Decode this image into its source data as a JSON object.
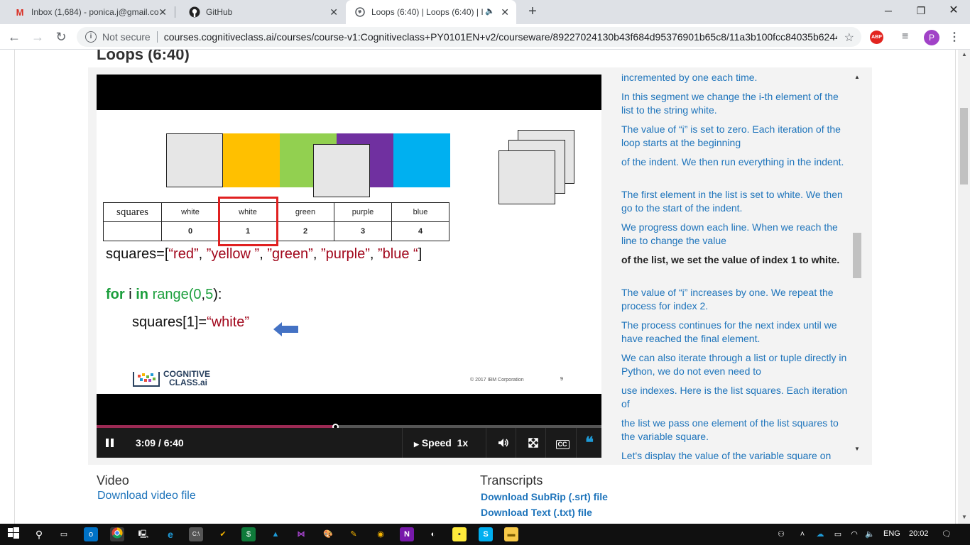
{
  "browser": {
    "tabs": [
      {
        "label": "Inbox (1,684) - ponica.j@gmail.co",
        "icon": "gmail-icon"
      },
      {
        "label": "GitHub",
        "icon": "github-icon"
      },
      {
        "label": "Loops (6:40) | Loops (6:40) | I",
        "icon": "globe-icon",
        "audio_icon": "speaker-icon"
      }
    ],
    "not_secure": "Not secure",
    "url": "courses.cognitiveclass.ai/courses/course-v1:Cognitiveclass+PY0101EN+v2/courseware/89227024130b43f684d95376901b65c8/11a3b100fcc84035b6244...",
    "avatar_letter": "P",
    "abp_label": "ABP"
  },
  "page": {
    "title": "Loops (6:40)"
  },
  "slide": {
    "table_label": "squares",
    "values": [
      "white",
      "white",
      "green",
      "purple",
      "blue"
    ],
    "indices": [
      "0",
      "1",
      "2",
      "3",
      "4"
    ],
    "code_line1_prefix": "squares=[",
    "code_line1_items": [
      "“red”",
      ", ",
      "”yellow ”",
      ", ",
      "”green”",
      ", ",
      "”purple”",
      ", ",
      "”blue “",
      "]"
    ],
    "code_for": "for",
    "code_i": " i ",
    "code_in": "in",
    "code_range": " range(",
    "code_0": "0",
    "code_comma": ",",
    "code_5": "5",
    "code_close": "):",
    "code_line3_prefix": "squares[1]=",
    "code_line3_value": "“white”",
    "logo_line1": "COGNITIVE",
    "logo_line2": "CLASS.ai",
    "copyright": "© 2017 IBM Corporation",
    "slide_number": "9",
    "square_colors": [
      "#e6e6e6",
      "#ffc000",
      "#92d050",
      "#7030a0",
      "#00b0f0"
    ]
  },
  "player": {
    "time": "3:09 / 6:40",
    "speed_label": "Speed",
    "speed_value": "1x",
    "progress": 0.4725,
    "progress_color": "#9c2a54"
  },
  "transcript": {
    "lines": [
      "incremented by one each time.",
      "In this segment we change the i-th element of the list to the string white.",
      "The value of “i” is set to zero. Each iteration of the loop starts at the beginning",
      "of the indent. We then run everything in the indent.",
      "The first element in the list is set to white. We then go to the start of the indent.",
      "We progress down each line. When we reach the line to change the value",
      "of the list, we set the value of index 1 to white.",
      "The value of “i” increases by one. We repeat the process for index 2.",
      "The process continues for the next index until we have reached the final element.",
      "We can also iterate through a list or tuple directly in Python, we do not even need to",
      "use indexes. Here is the list squares. Each iteration of",
      "the list we pass one element of the list squares to the variable square.",
      "Let's display the value of the variable square on"
    ],
    "current_index": 6
  },
  "below": {
    "video_heading": "Video",
    "video_download": "Download video file",
    "transcripts_heading": "Transcripts",
    "srt_download": "Download SubRip (.srt) file",
    "txt_download": "Download Text (.txt) file"
  },
  "taskbar": {
    "language": "ENG",
    "time": "20:02"
  }
}
